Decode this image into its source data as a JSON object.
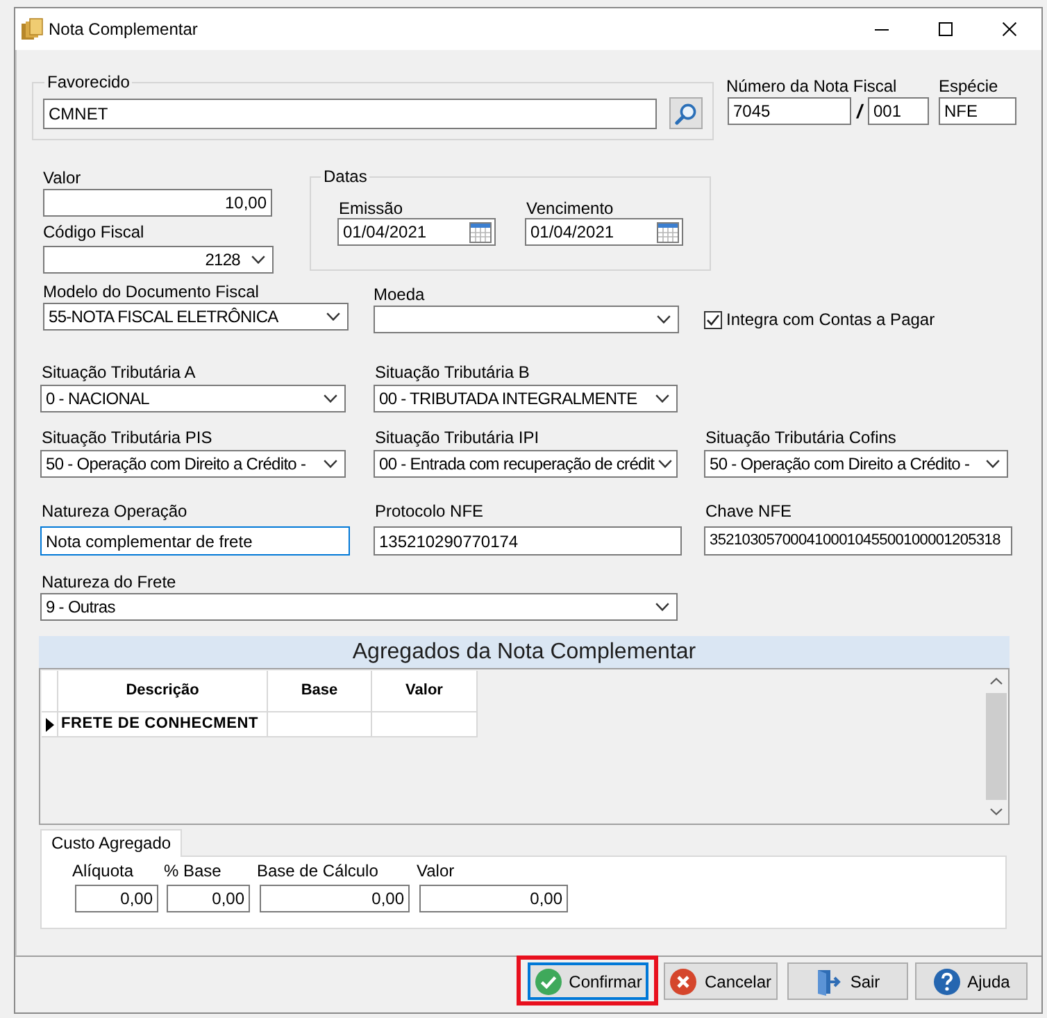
{
  "window": {
    "title": "Nota Complementar"
  },
  "favorecido": {
    "label": "Favorecido",
    "value": "CMNET"
  },
  "numero_nota_fiscal": {
    "label": "Número da Nota Fiscal",
    "numero": "7045",
    "separator": "/",
    "serie": "001"
  },
  "especie": {
    "label": "Espécie",
    "value": "NFE"
  },
  "valor": {
    "label": "Valor",
    "value": "10,00"
  },
  "codigo_fiscal": {
    "label": "Código Fiscal",
    "value": "2128"
  },
  "datas": {
    "title": "Datas",
    "fields": [
      {
        "label": "Emissão",
        "value": "01/04/2021"
      },
      {
        "label": "Vencimento",
        "value": "01/04/2021"
      }
    ]
  },
  "modelo_documento": {
    "label": "Modelo do Documento Fiscal",
    "value": "55-NOTA FISCAL ELETRÔNICA"
  },
  "moeda": {
    "label": "Moeda"
  },
  "integra_contas": {
    "label": "Integra com Contas a Pagar",
    "checked": true
  },
  "situacao_rows": [
    [
      {
        "label": "Situação Tributária A",
        "value": "0 - NACIONAL"
      },
      {
        "label": "Situação Tributária B",
        "value": "00 - TRIBUTADA INTEGRALMENTE"
      }
    ],
    [
      {
        "label": "Situação Tributária PIS",
        "value": "50 - Operação com Direito a Crédito -"
      },
      {
        "label": "Situação Tributária IPI",
        "value": "00 - Entrada com recuperação de crédit"
      },
      {
        "label": "Situação Tributária Cofins",
        "value": "50 - Operação com Direito a Crédito -"
      }
    ]
  ],
  "text_fields": [
    {
      "label": "Natureza Operação",
      "value": "Nota complementar de frete",
      "focused": true
    },
    {
      "label": "Protocolo NFE",
      "value": "135210290770174",
      "focused": false
    },
    {
      "label": "Chave NFE",
      "value": "352103057000410001045500100001205318",
      "focused": false
    }
  ],
  "natureza_frete": {
    "label": "Natureza do Frete",
    "value": "9 - Outras"
  },
  "agregados": {
    "title": "Agregados da Nota Complementar",
    "columns": [
      "Descrição",
      "Base",
      "Valor"
    ],
    "rows": [
      {
        "selected": true,
        "descricao": "FRETE DE CONHECMENT"
      }
    ]
  },
  "custo_agregado": {
    "tabs": [
      {
        "label": "Custo Agregado",
        "selected": true
      }
    ],
    "fields": [
      {
        "label": "Alíquota",
        "value": "0,00"
      },
      {
        "label": "% Base",
        "value": "0,00"
      },
      {
        "label": "Base de Cálculo",
        "value": "0,00"
      },
      {
        "label": "Valor",
        "value": "0,00"
      }
    ]
  },
  "buttons": [
    {
      "kind": "confirm",
      "label": "Confirmar",
      "focused": true,
      "highlighted": true
    },
    {
      "kind": "cancel",
      "label": "Cancelar",
      "focused": false,
      "highlighted": false
    },
    {
      "kind": "exit",
      "label": "Sair",
      "focused": false,
      "highlighted": false
    },
    {
      "kind": "help",
      "label": "Ajuda",
      "focused": false,
      "highlighted": false
    }
  ]
}
